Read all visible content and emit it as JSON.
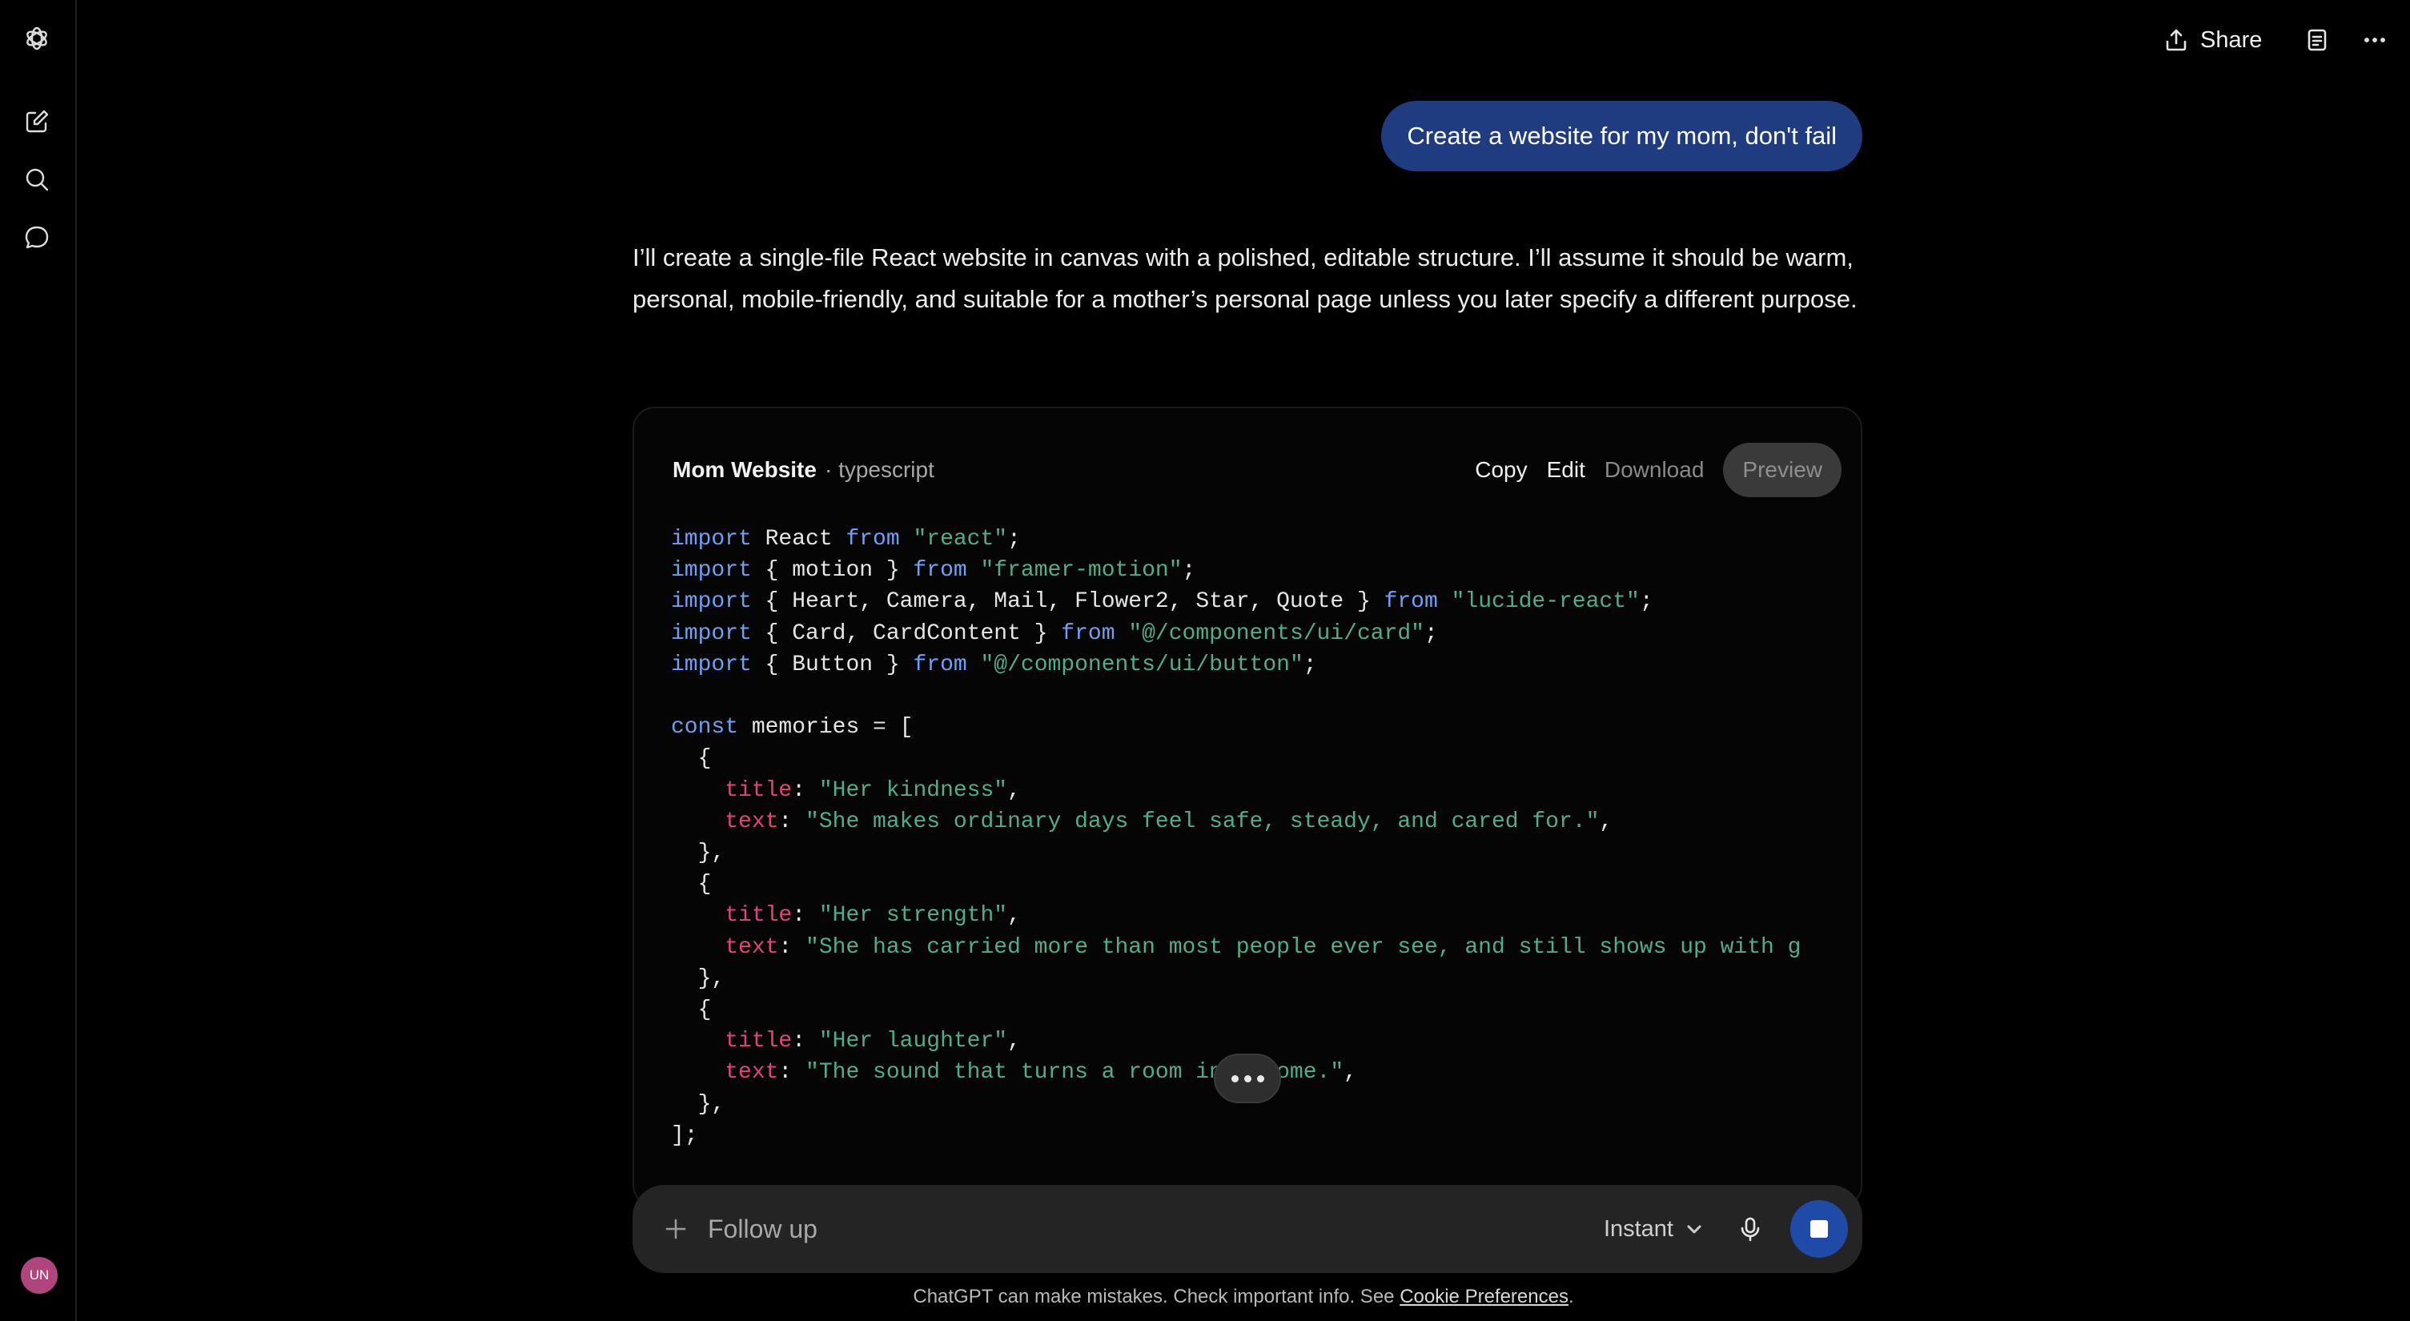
{
  "topbar": {
    "share_label": "Share"
  },
  "conversation": {
    "user_message": "Create a website for my mom, don't fail",
    "assistant_text": "I’ll create a single-file React website in canvas with a polished, editable structure. I’ll assume it should be warm, personal, mobile-friendly, and suitable for a mother’s personal page unless you later specify a different purpose."
  },
  "canvas": {
    "title": "Mom Website",
    "separator": " · ",
    "language": "typescript",
    "actions": {
      "copy": "Copy",
      "edit": "Edit",
      "download": "Download",
      "preview": "Preview"
    },
    "code_lines": [
      [
        [
          "kw",
          "import"
        ],
        [
          "",
          "React "
        ],
        [
          "kw",
          "from"
        ],
        [
          "str",
          " \"react\""
        ],
        [
          "",
          ";"
        ]
      ],
      [
        [
          "kw",
          "import"
        ],
        [
          "",
          "{ motion } "
        ],
        [
          "kw",
          "from"
        ],
        [
          "str",
          " \"framer-motion\""
        ],
        [
          "",
          ";"
        ]
      ],
      [
        [
          "kw",
          "import"
        ],
        [
          "",
          "{ Heart, Camera, Mail, Flower2, Star, Quote } "
        ],
        [
          "kw",
          "from"
        ],
        [
          "str",
          " \"lucide-react\""
        ],
        [
          "",
          ";"
        ]
      ],
      [
        [
          "kw",
          "import"
        ],
        [
          "",
          "{ Card, CardContent } "
        ],
        [
          "kw",
          "from"
        ],
        [
          "str",
          " \"@/components/ui/card\""
        ],
        [
          "",
          ";"
        ]
      ],
      [
        [
          "kw",
          "import"
        ],
        [
          "",
          "{ Button } "
        ],
        [
          "kw",
          "from"
        ],
        [
          "str",
          " \"@/components/ui/button\""
        ],
        [
          "",
          ";"
        ]
      ],
      [],
      [
        [
          "kw",
          "const"
        ],
        [
          "",
          " memories = ["
        ]
      ],
      [
        [
          "",
          "  {"
        ]
      ],
      [
        [
          "prop",
          "    title"
        ],
        [
          "",
          ": "
        ],
        [
          "str",
          "\"Her kindness\""
        ],
        [
          "",
          ","
        ]
      ],
      [
        [
          "prop",
          "    text"
        ],
        [
          "",
          ": "
        ],
        [
          "str",
          "\"She makes ordinary days feel safe, steady, and cared for.\""
        ],
        [
          "",
          ","
        ]
      ],
      [
        [
          "",
          "  },"
        ]
      ],
      [
        [
          "",
          "  {"
        ]
      ],
      [
        [
          "prop",
          "    title"
        ],
        [
          "",
          ": "
        ],
        [
          "str",
          "\"Her strength\""
        ],
        [
          "",
          ","
        ]
      ],
      [
        [
          "prop",
          "    text"
        ],
        [
          "",
          ": "
        ],
        [
          "str",
          "\"She has carried more than most people ever see, and still shows up with g"
        ]
      ],
      [
        [
          "",
          "  },"
        ]
      ],
      [
        [
          "",
          "  {"
        ]
      ],
      [
        [
          "prop",
          "    title"
        ],
        [
          "",
          ": "
        ],
        [
          "str",
          "\"Her laughter\""
        ],
        [
          "",
          ","
        ]
      ],
      [
        [
          "prop",
          "    text"
        ],
        [
          "",
          ": "
        ],
        [
          "str",
          "\"The sound that turns a room into home.\""
        ],
        [
          "",
          ","
        ]
      ],
      [
        [
          "",
          "  },"
        ]
      ],
      [
        [
          "",
          "];"
        ]
      ]
    ]
  },
  "composer": {
    "placeholder": "Follow up",
    "model_label": "Instant"
  },
  "footer": {
    "disclaimer_prefix": "ChatGPT can make mistakes. Check important info. See ",
    "cookie_link": "Cookie Preferences",
    "disclaimer_suffix": "."
  },
  "user": {
    "avatar_initials": "UN"
  },
  "colors": {
    "user_bubble": "#1f3c80",
    "stop_button": "#1f4aa8",
    "keyword": "#6fa0f2",
    "string": "#4fae8c",
    "property": "#e0437d",
    "avatar": "#b0447c"
  },
  "icons": [
    "openai-logo-icon",
    "new-chat-icon",
    "search-icon",
    "chat-bubble-icon",
    "share-icon",
    "canvas-doc-icon",
    "more-options-icon",
    "plus-icon",
    "chevron-down-icon",
    "microphone-icon",
    "stop-icon"
  ]
}
